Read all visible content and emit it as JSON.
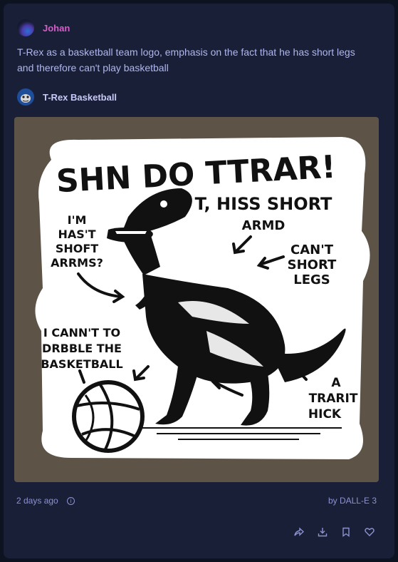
{
  "author": {
    "name": "Johan",
    "color": "#d75cc9"
  },
  "prompt": "T-Rex as a basketball team logo, emphasis on the fact that he has short legs and therefore can't play basketball",
  "response": {
    "bot_name": "T-Rex Basketball",
    "image_text": {
      "headline": "SHN DO TTRAR!",
      "caption_top_right": [
        "T, HISS SHORT",
        "ARMD"
      ],
      "caption_left": [
        "I'M",
        "HAS'T",
        "SHOFT",
        "ARRMS?"
      ],
      "caption_right": [
        "CAN'T",
        "SHORT",
        "LEGS"
      ],
      "caption_bottom_left": [
        "I CANN'T TO",
        "DRBBLE THE",
        "BASKETBALL"
      ],
      "caption_bottom_right": [
        "A",
        "TRARIT",
        "HICK"
      ]
    }
  },
  "footer": {
    "timestamp": "2 days ago",
    "info_icon": "info-icon",
    "attribution": "by DALL-E 3"
  },
  "actions": [
    {
      "name": "share-icon"
    },
    {
      "name": "download-icon"
    },
    {
      "name": "bookmark-icon"
    },
    {
      "name": "heart-icon"
    }
  ],
  "colors": {
    "background": "#0e1322",
    "card": "#191f36",
    "accent_text": "#aeb6ef",
    "image_bg": "#5d5447"
  }
}
